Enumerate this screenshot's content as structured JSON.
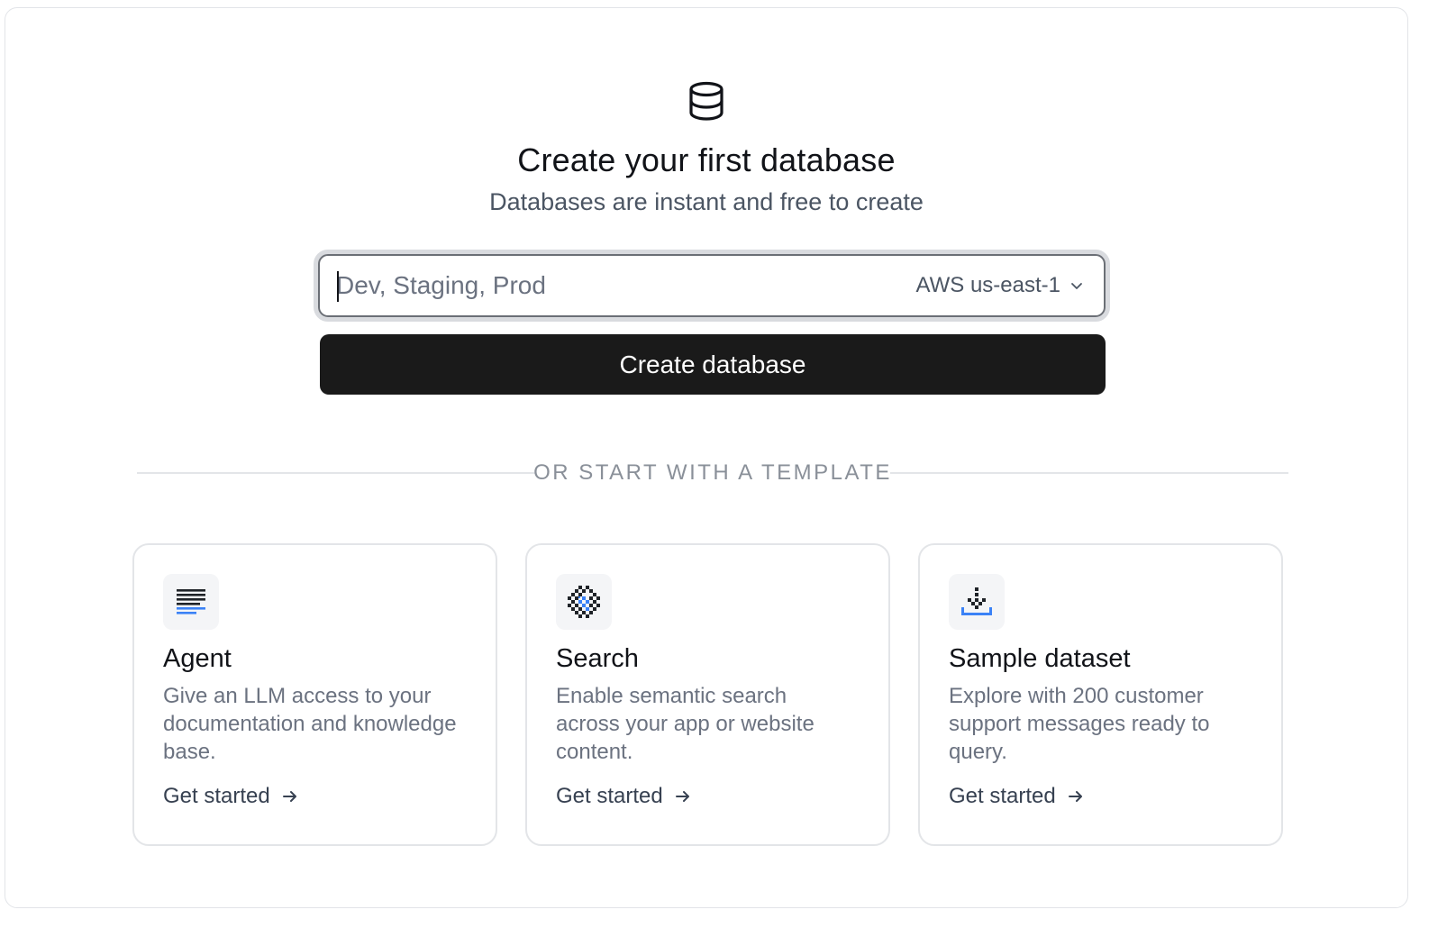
{
  "hero": {
    "icon": "database-icon",
    "title": "Create your first database",
    "subtitle": "Databases are instant and free to create"
  },
  "form": {
    "name_placeholder": "Dev, Staging, Prod",
    "name_value": "",
    "region": "AWS us-east-1",
    "create_label": "Create database"
  },
  "divider": {
    "label": "OR START WITH A TEMPLATE"
  },
  "templates": [
    {
      "icon": "document-lines-icon",
      "title": "Agent",
      "description": "Give an LLM access to your documentation and knowledge base.",
      "cta": "Get started"
    },
    {
      "icon": "search-grid-icon",
      "title": "Search",
      "description": "Enable semantic search across your app or website content.",
      "cta": "Get started"
    },
    {
      "icon": "import-dataset-icon",
      "title": "Sample dataset",
      "description": "Explore with 200 customer support messages ready to query.",
      "cta": "Get started"
    }
  ],
  "colors": {
    "accent_blue": "#3b82f6",
    "button_bg": "#1a1a1a"
  }
}
